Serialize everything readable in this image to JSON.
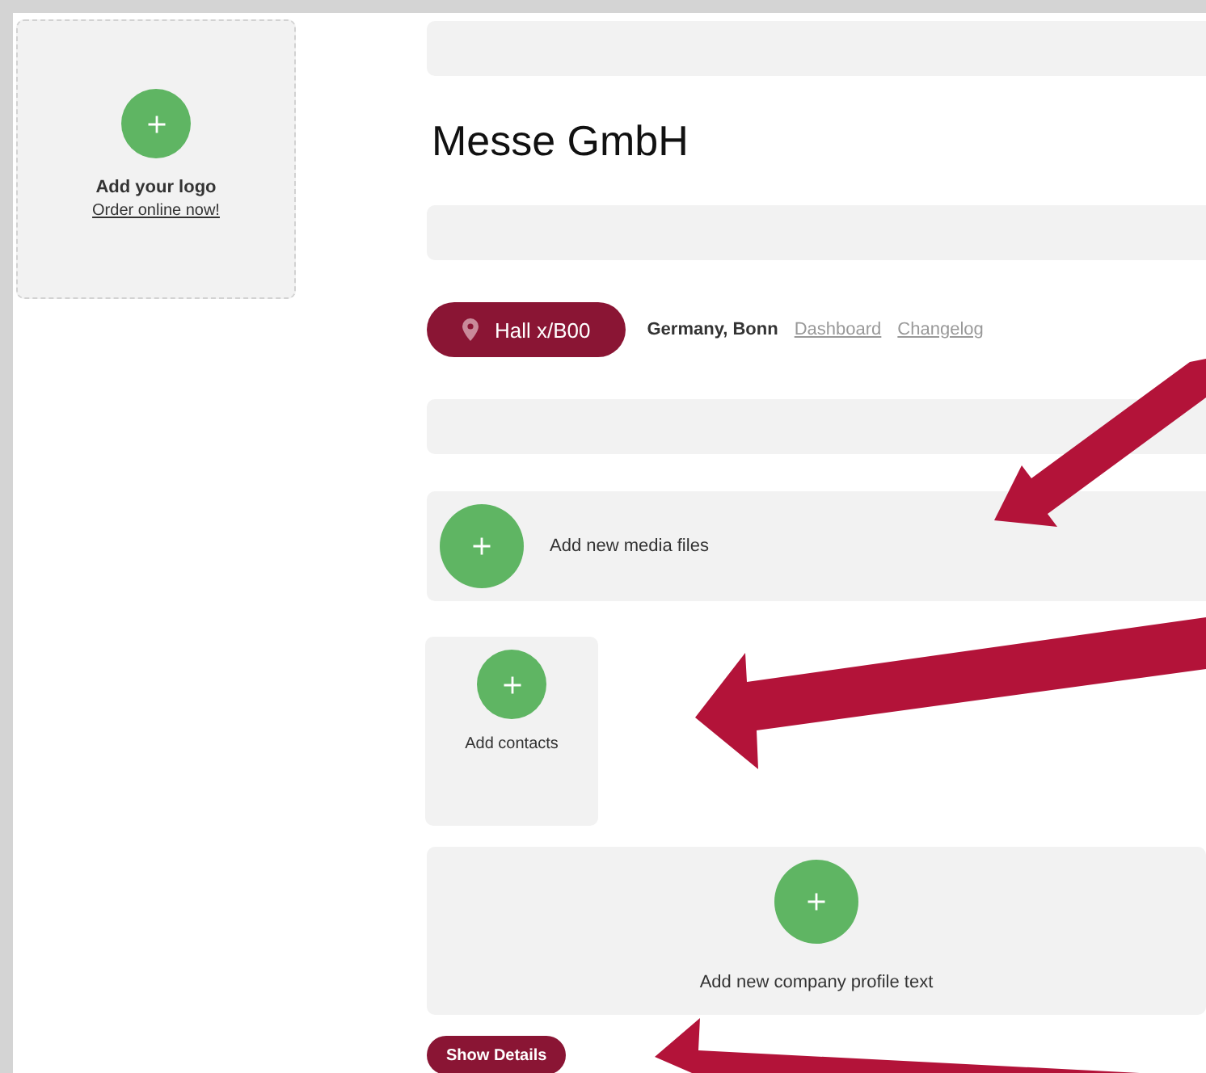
{
  "logo": {
    "title": "Add your logo",
    "link": "Order online now!"
  },
  "company_name": "Messe GmbH",
  "location": {
    "hall": "Hall x/B00",
    "city": "Germany, Bonn"
  },
  "links": [
    {
      "label": "Dashboard"
    },
    {
      "label": "Changelog"
    }
  ],
  "media": {
    "label": "Add new media files"
  },
  "contacts": {
    "label": "Add contacts"
  },
  "profile": {
    "label": "Add new company profile text"
  },
  "show_details": {
    "label": "Show Details"
  }
}
